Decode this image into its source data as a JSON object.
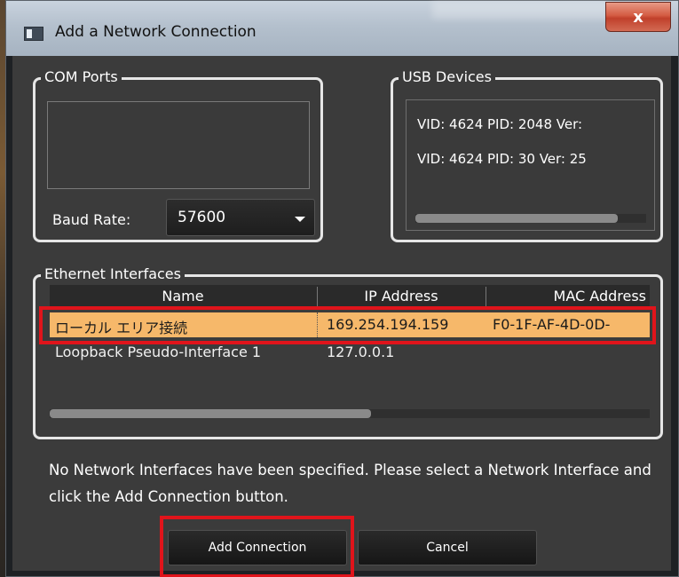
{
  "window": {
    "title": "Add a Network Connection",
    "close_glyph": "x"
  },
  "com_ports": {
    "legend": "COM Ports",
    "baud_label": "Baud Rate:",
    "baud_value": "57600"
  },
  "usb_devices": {
    "legend": "USB Devices",
    "items": [
      "VID: 4624 PID: 2048 Ver:",
      "VID: 4624 PID: 30 Ver: 25"
    ]
  },
  "ethernet": {
    "legend": "Ethernet Interfaces",
    "columns": [
      "Name",
      "IP Address",
      "MAC Address"
    ],
    "rows": [
      {
        "name": "ローカル エリア接続",
        "ip": "169.254.194.159",
        "mac": "F0-1F-AF-4D-0D-",
        "selected": true
      },
      {
        "name": "Loopback Pseudo-Interface 1",
        "ip": "127.0.0.1",
        "mac": "",
        "selected": false
      }
    ]
  },
  "message": "No Network Interfaces have been specified. Please select a Network Interface and click the Add Connection button.",
  "buttons": {
    "add": "Add Connection",
    "cancel": "Cancel"
  },
  "colors": {
    "selection": "#f6b86a",
    "highlight_box": "#e0141b",
    "close_button": "#c0402b"
  }
}
